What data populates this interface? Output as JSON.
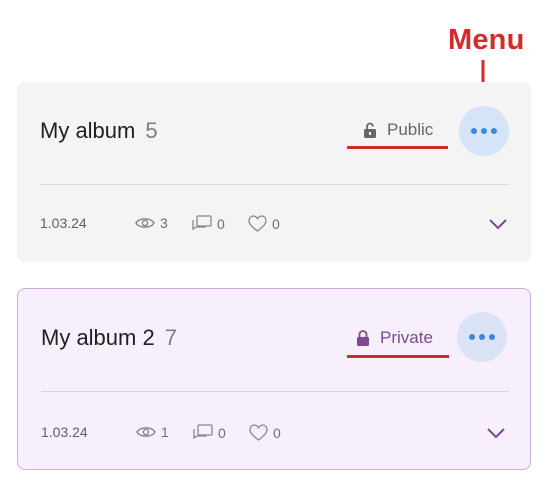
{
  "annotation": {
    "label": "Menu",
    "color": "#d32a2a"
  },
  "albums": [
    {
      "title": "My album",
      "count": "5",
      "visibility": "Public",
      "visibility_icon": "unlocked-padlock-icon",
      "date": "1.03.24",
      "views": "3",
      "comments": "0",
      "likes": "0",
      "background": "#f4f4f4"
    },
    {
      "title": "My album 2",
      "count": "7",
      "visibility": "Private",
      "visibility_icon": "locked-padlock-icon",
      "date": "1.03.24",
      "views": "1",
      "comments": "0",
      "likes": "0",
      "background": "#f7effc"
    }
  ]
}
